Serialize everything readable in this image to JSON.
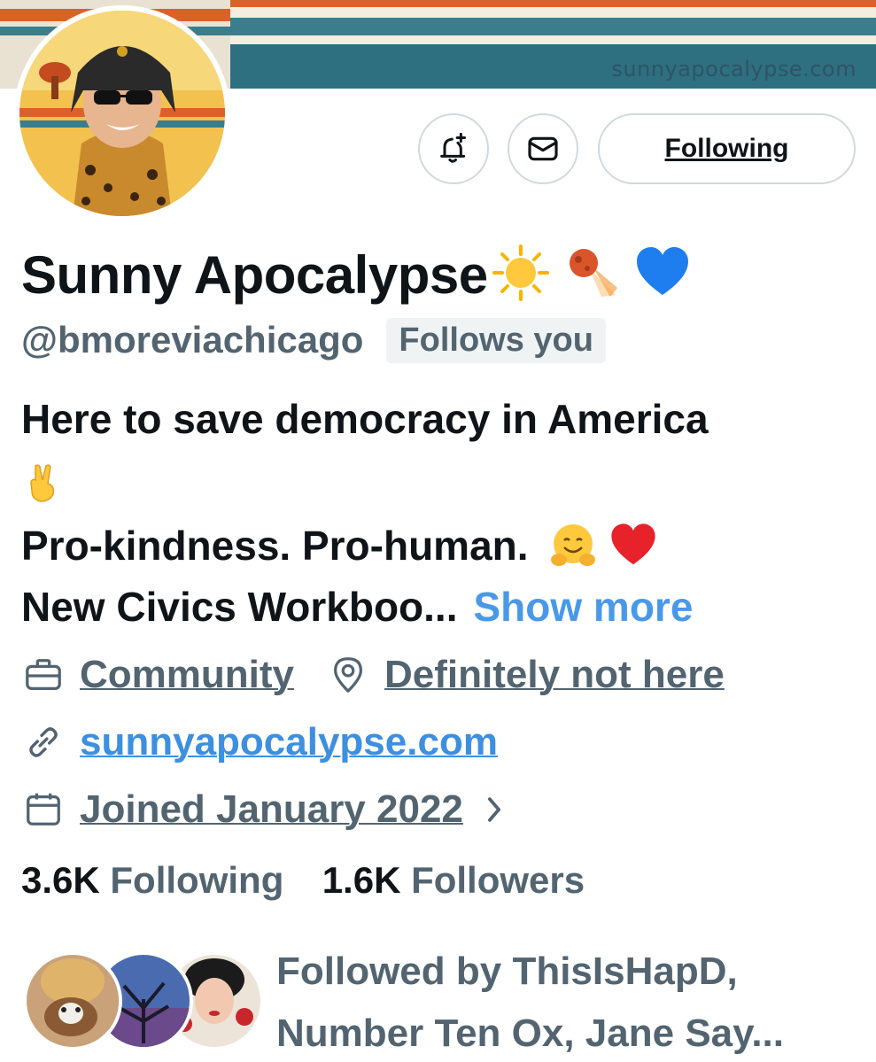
{
  "banner": {
    "url_text": "sunnyapocalypse.com"
  },
  "actions": {
    "notify_icon": "bell-plus-icon",
    "message_icon": "envelope-icon",
    "following_label": "Following"
  },
  "profile": {
    "display_name": "Sunny Apocalypse",
    "name_emojis": [
      "☀️",
      "☄️",
      "💙"
    ],
    "handle": "@bmoreviachicago",
    "follows_you_badge": "Follows you"
  },
  "bio": {
    "line1": "Here to save democracy in America",
    "line1_emoji": "✌️",
    "line2": "Pro-kindness. Pro-human.",
    "line2_emojis": [
      "🤗",
      "❤️"
    ],
    "line3": "New Civics Workboo...",
    "show_more": "Show more"
  },
  "meta": {
    "category": "Community",
    "location": "Definitely not here",
    "website": "sunnyapocalypse.com",
    "joined": "Joined January 2022"
  },
  "stats": {
    "following_count": "3.6K",
    "following_label": "Following",
    "followers_count": "1.6K",
    "followers_label": "Followers"
  },
  "followed_by": {
    "line1": "Followed by ThisIsHapD,",
    "line2": "Number Ten Ox, Jane Say..."
  },
  "colors": {
    "link_blue": "#4a99e9",
    "secondary_text": "#536471",
    "border": "#cfd9de",
    "banner_teal": "#2e6f80",
    "banner_orange": "#d9622b"
  }
}
